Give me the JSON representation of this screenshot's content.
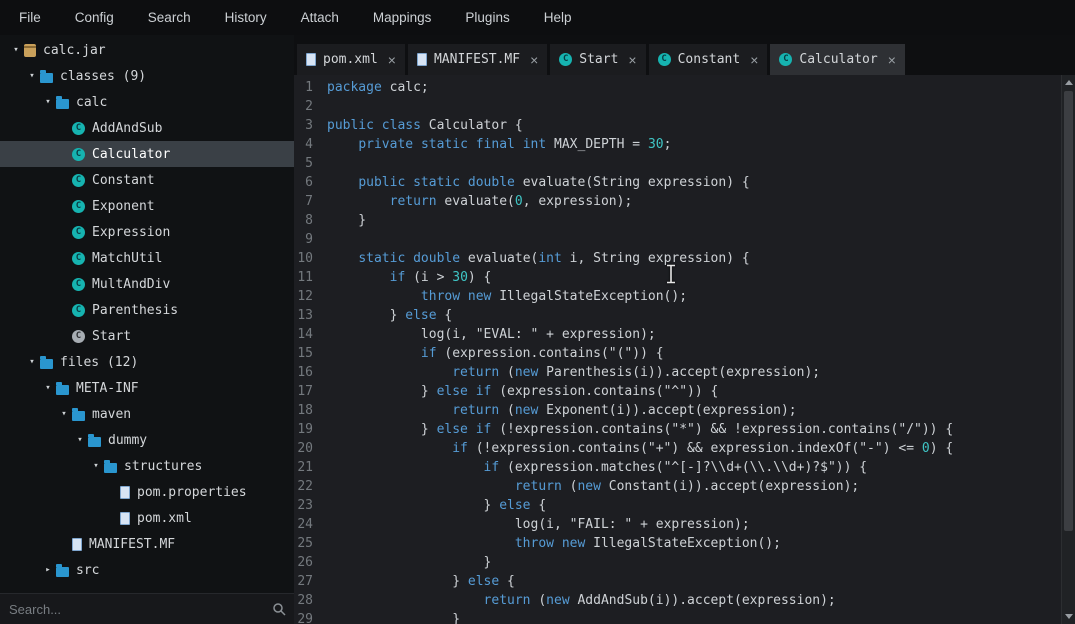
{
  "menubar": {
    "items": [
      "File",
      "Config",
      "Search",
      "History",
      "Attach",
      "Mappings",
      "Plugins",
      "Help"
    ]
  },
  "sidebar": {
    "tree": [
      {
        "label": "calc.jar",
        "level": 0,
        "icon": "jar",
        "arrow": "expanded"
      },
      {
        "label": "classes (9)",
        "level": 1,
        "icon": "folder",
        "arrow": "expanded"
      },
      {
        "label": "calc",
        "level": 2,
        "icon": "folder",
        "arrow": "expanded"
      },
      {
        "label": "AddAndSub",
        "level": 3,
        "icon": "class"
      },
      {
        "label": "Calculator",
        "level": 3,
        "icon": "class",
        "selected": true
      },
      {
        "label": "Constant",
        "level": 3,
        "icon": "class"
      },
      {
        "label": "Exponent",
        "level": 3,
        "icon": "class"
      },
      {
        "label": "Expression",
        "level": 3,
        "icon": "class"
      },
      {
        "label": "MatchUtil",
        "level": 3,
        "icon": "class"
      },
      {
        "label": "MultAndDiv",
        "level": 3,
        "icon": "class"
      },
      {
        "label": "Parenthesis",
        "level": 3,
        "icon": "class"
      },
      {
        "label": "Start",
        "level": 3,
        "icon": "class-gray"
      },
      {
        "label": "files (12)",
        "level": 1,
        "icon": "folder",
        "arrow": "expanded"
      },
      {
        "label": "META-INF",
        "level": 2,
        "icon": "folder",
        "arrow": "expanded"
      },
      {
        "label": "maven",
        "level": 3,
        "icon": "folder",
        "arrow": "expanded"
      },
      {
        "label": "dummy",
        "level": 4,
        "icon": "folder",
        "arrow": "expanded"
      },
      {
        "label": "structures",
        "level": 5,
        "icon": "folder",
        "arrow": "expanded"
      },
      {
        "label": "pom.properties",
        "level": 6,
        "icon": "file"
      },
      {
        "label": "pom.xml",
        "level": 6,
        "icon": "file"
      },
      {
        "label": "MANIFEST.MF",
        "level": 3,
        "icon": "file"
      },
      {
        "label": "src",
        "level": 2,
        "icon": "folder",
        "arrow": "collapsed"
      }
    ],
    "search": {
      "placeholder": "Search..."
    }
  },
  "tabs": [
    {
      "label": "pom.xml",
      "icon": "file",
      "close": "×"
    },
    {
      "label": "MANIFEST.MF",
      "icon": "file",
      "close": "×"
    },
    {
      "label": "Start",
      "icon": "class",
      "close": "×"
    },
    {
      "label": "Constant",
      "icon": "class",
      "close": "×"
    },
    {
      "label": "Calculator",
      "icon": "class",
      "close": "×",
      "active": true
    }
  ],
  "editor": {
    "token_colors": {
      "k": "#569cd6",
      "n": "#3fc5c5",
      "s": "#ced2d6",
      "p": "#ced2d6"
    },
    "lines": [
      {
        "n": 1,
        "t": [
          [
            "k",
            "package"
          ],
          [
            "p",
            " calc;"
          ]
        ]
      },
      {
        "n": 2,
        "t": []
      },
      {
        "n": 3,
        "t": [
          [
            "k",
            "public"
          ],
          [
            "p",
            " "
          ],
          [
            "k",
            "class"
          ],
          [
            "p",
            " Calculator {"
          ]
        ]
      },
      {
        "n": 4,
        "t": [
          [
            "p",
            "    "
          ],
          [
            "k",
            "private"
          ],
          [
            "p",
            " "
          ],
          [
            "k",
            "static"
          ],
          [
            "p",
            " "
          ],
          [
            "k",
            "final"
          ],
          [
            "p",
            " "
          ],
          [
            "k",
            "int"
          ],
          [
            "p",
            " MAX_DEPTH = "
          ],
          [
            "n",
            "30"
          ],
          [
            "p",
            ";"
          ]
        ]
      },
      {
        "n": 5,
        "t": []
      },
      {
        "n": 6,
        "t": [
          [
            "p",
            "    "
          ],
          [
            "k",
            "public"
          ],
          [
            "p",
            " "
          ],
          [
            "k",
            "static"
          ],
          [
            "p",
            " "
          ],
          [
            "k",
            "double"
          ],
          [
            "p",
            " evaluate(String expression) {"
          ]
        ]
      },
      {
        "n": 7,
        "t": [
          [
            "p",
            "        "
          ],
          [
            "k",
            "return"
          ],
          [
            "p",
            " evaluate("
          ],
          [
            "n",
            "0"
          ],
          [
            "p",
            ", expression);"
          ]
        ]
      },
      {
        "n": 8,
        "t": [
          [
            "p",
            "    }"
          ]
        ]
      },
      {
        "n": 9,
        "t": []
      },
      {
        "n": 10,
        "t": [
          [
            "p",
            "    "
          ],
          [
            "k",
            "static"
          ],
          [
            "p",
            " "
          ],
          [
            "k",
            "double"
          ],
          [
            "p",
            " evaluate("
          ],
          [
            "k",
            "int"
          ],
          [
            "p",
            " i, String expression) {"
          ]
        ]
      },
      {
        "n": 11,
        "t": [
          [
            "p",
            "        "
          ],
          [
            "k",
            "if"
          ],
          [
            "p",
            " (i > "
          ],
          [
            "n",
            "30"
          ],
          [
            "p",
            ") {"
          ]
        ]
      },
      {
        "n": 12,
        "t": [
          [
            "p",
            "            "
          ],
          [
            "k",
            "throw"
          ],
          [
            "p",
            " "
          ],
          [
            "k",
            "new"
          ],
          [
            "p",
            " IllegalStateException();"
          ]
        ]
      },
      {
        "n": 13,
        "t": [
          [
            "p",
            "        } "
          ],
          [
            "k",
            "else"
          ],
          [
            "p",
            " {"
          ]
        ]
      },
      {
        "n": 14,
        "t": [
          [
            "p",
            "            log(i, "
          ],
          [
            "s",
            "\"EVAL: \""
          ],
          [
            "p",
            " + expression);"
          ]
        ]
      },
      {
        "n": 15,
        "t": [
          [
            "p",
            "            "
          ],
          [
            "k",
            "if"
          ],
          [
            "p",
            " (expression.contains("
          ],
          [
            "s",
            "\"(\""
          ],
          [
            "p",
            ")) {"
          ]
        ]
      },
      {
        "n": 16,
        "t": [
          [
            "p",
            "                "
          ],
          [
            "k",
            "return"
          ],
          [
            "p",
            " ("
          ],
          [
            "k",
            "new"
          ],
          [
            "p",
            " Parenthesis(i)).accept(expression);"
          ]
        ]
      },
      {
        "n": 17,
        "t": [
          [
            "p",
            "            } "
          ],
          [
            "k",
            "else"
          ],
          [
            "p",
            " "
          ],
          [
            "k",
            "if"
          ],
          [
            "p",
            " (expression.contains("
          ],
          [
            "s",
            "\"^\""
          ],
          [
            "p",
            ")) {"
          ]
        ]
      },
      {
        "n": 18,
        "t": [
          [
            "p",
            "                "
          ],
          [
            "k",
            "return"
          ],
          [
            "p",
            " ("
          ],
          [
            "k",
            "new"
          ],
          [
            "p",
            " Exponent(i)).accept(expression);"
          ]
        ]
      },
      {
        "n": 19,
        "t": [
          [
            "p",
            "            } "
          ],
          [
            "k",
            "else"
          ],
          [
            "p",
            " "
          ],
          [
            "k",
            "if"
          ],
          [
            "p",
            " (!expression.contains("
          ],
          [
            "s",
            "\"*\""
          ],
          [
            "p",
            ") && !expression.contains("
          ],
          [
            "s",
            "\"/\""
          ],
          [
            "p",
            ")) {"
          ]
        ]
      },
      {
        "n": 20,
        "t": [
          [
            "p",
            "                "
          ],
          [
            "k",
            "if"
          ],
          [
            "p",
            " (!expression.contains("
          ],
          [
            "s",
            "\"+\""
          ],
          [
            "p",
            ") && expression.indexOf("
          ],
          [
            "s",
            "\"-\""
          ],
          [
            "p",
            ") <= "
          ],
          [
            "n",
            "0"
          ],
          [
            "p",
            ") {"
          ]
        ]
      },
      {
        "n": 21,
        "t": [
          [
            "p",
            "                    "
          ],
          [
            "k",
            "if"
          ],
          [
            "p",
            " (expression.matches("
          ],
          [
            "s",
            "\"^[-]?\\\\d+(\\\\.\\\\d+)?$\""
          ],
          [
            "p",
            ")) {"
          ]
        ]
      },
      {
        "n": 22,
        "t": [
          [
            "p",
            "                        "
          ],
          [
            "k",
            "return"
          ],
          [
            "p",
            " ("
          ],
          [
            "k",
            "new"
          ],
          [
            "p",
            " Constant(i)).accept(expression);"
          ]
        ]
      },
      {
        "n": 23,
        "t": [
          [
            "p",
            "                    } "
          ],
          [
            "k",
            "else"
          ],
          [
            "p",
            " {"
          ]
        ]
      },
      {
        "n": 24,
        "t": [
          [
            "p",
            "                        log(i, "
          ],
          [
            "s",
            "\"FAIL: \""
          ],
          [
            "p",
            " + expression);"
          ]
        ]
      },
      {
        "n": 25,
        "t": [
          [
            "p",
            "                        "
          ],
          [
            "k",
            "throw"
          ],
          [
            "p",
            " "
          ],
          [
            "k",
            "new"
          ],
          [
            "p",
            " IllegalStateException();"
          ]
        ]
      },
      {
        "n": 26,
        "t": [
          [
            "p",
            "                    }"
          ]
        ]
      },
      {
        "n": 27,
        "t": [
          [
            "p",
            "                } "
          ],
          [
            "k",
            "else"
          ],
          [
            "p",
            " {"
          ]
        ]
      },
      {
        "n": 28,
        "t": [
          [
            "p",
            "                    "
          ],
          [
            "k",
            "return"
          ],
          [
            "p",
            " ("
          ],
          [
            "k",
            "new"
          ],
          [
            "p",
            " AddAndSub(i)).accept(expression);"
          ]
        ]
      },
      {
        "n": 29,
        "t": [
          [
            "p",
            "                }"
          ]
        ]
      }
    ]
  },
  "colors": {
    "keyword": "#569cd6",
    "number": "#3fc5c5",
    "selection_bg": "#3a4046",
    "folder_icon": "#2a96cf",
    "class_icon": "#16b3b0",
    "editor_bg": "#1d1e22"
  }
}
